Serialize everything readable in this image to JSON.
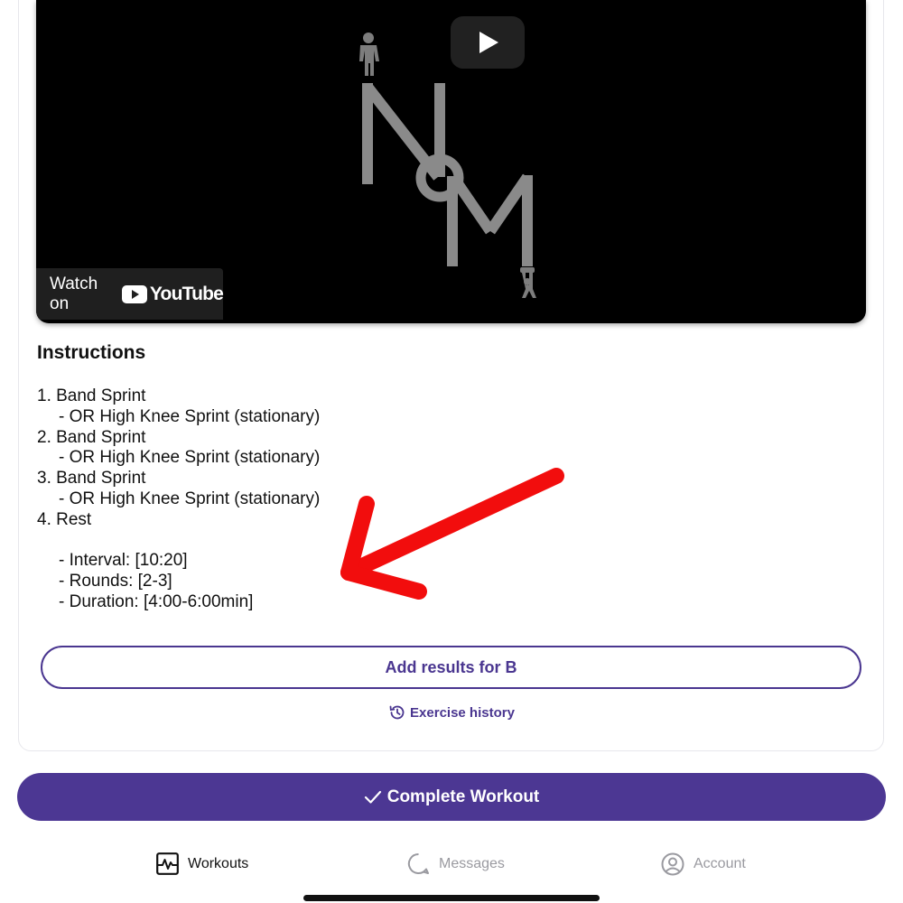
{
  "video": {
    "watch_on_text": "Watch on",
    "youtube_brand": "YouTube",
    "logo_letters": "NOM"
  },
  "instructions": {
    "title": "Instructions",
    "lines": [
      {
        "text": "1. Band Sprint",
        "indent": false
      },
      {
        "text": "- OR High Knee Sprint (stationary)",
        "indent": true
      },
      {
        "text": "2. Band Sprint",
        "indent": false
      },
      {
        "text": "- OR High Knee Sprint (stationary)",
        "indent": true
      },
      {
        "text": "3. Band Sprint",
        "indent": false
      },
      {
        "text": "- OR High Knee Sprint (stationary)",
        "indent": true
      },
      {
        "text": "4. Rest",
        "indent": false
      },
      {
        "text": "",
        "indent": false
      },
      {
        "text": "- Interval: [10:20]",
        "indent": true
      },
      {
        "text": "- Rounds: [2-3]",
        "indent": true
      },
      {
        "text": "- Duration: [4:00-6:00min]",
        "indent": true
      }
    ]
  },
  "actions": {
    "add_results_label": "Add results for B",
    "exercise_history_label": "Exercise history",
    "complete_workout_label": "Complete Workout"
  },
  "tabbar": {
    "workouts_label": "Workouts",
    "messages_label": "Messages",
    "account_label": "Account"
  },
  "colors": {
    "accent": "#4c3793",
    "annotation_arrow": "#f20d0d",
    "inactive_tab": "#9a9aa0"
  }
}
